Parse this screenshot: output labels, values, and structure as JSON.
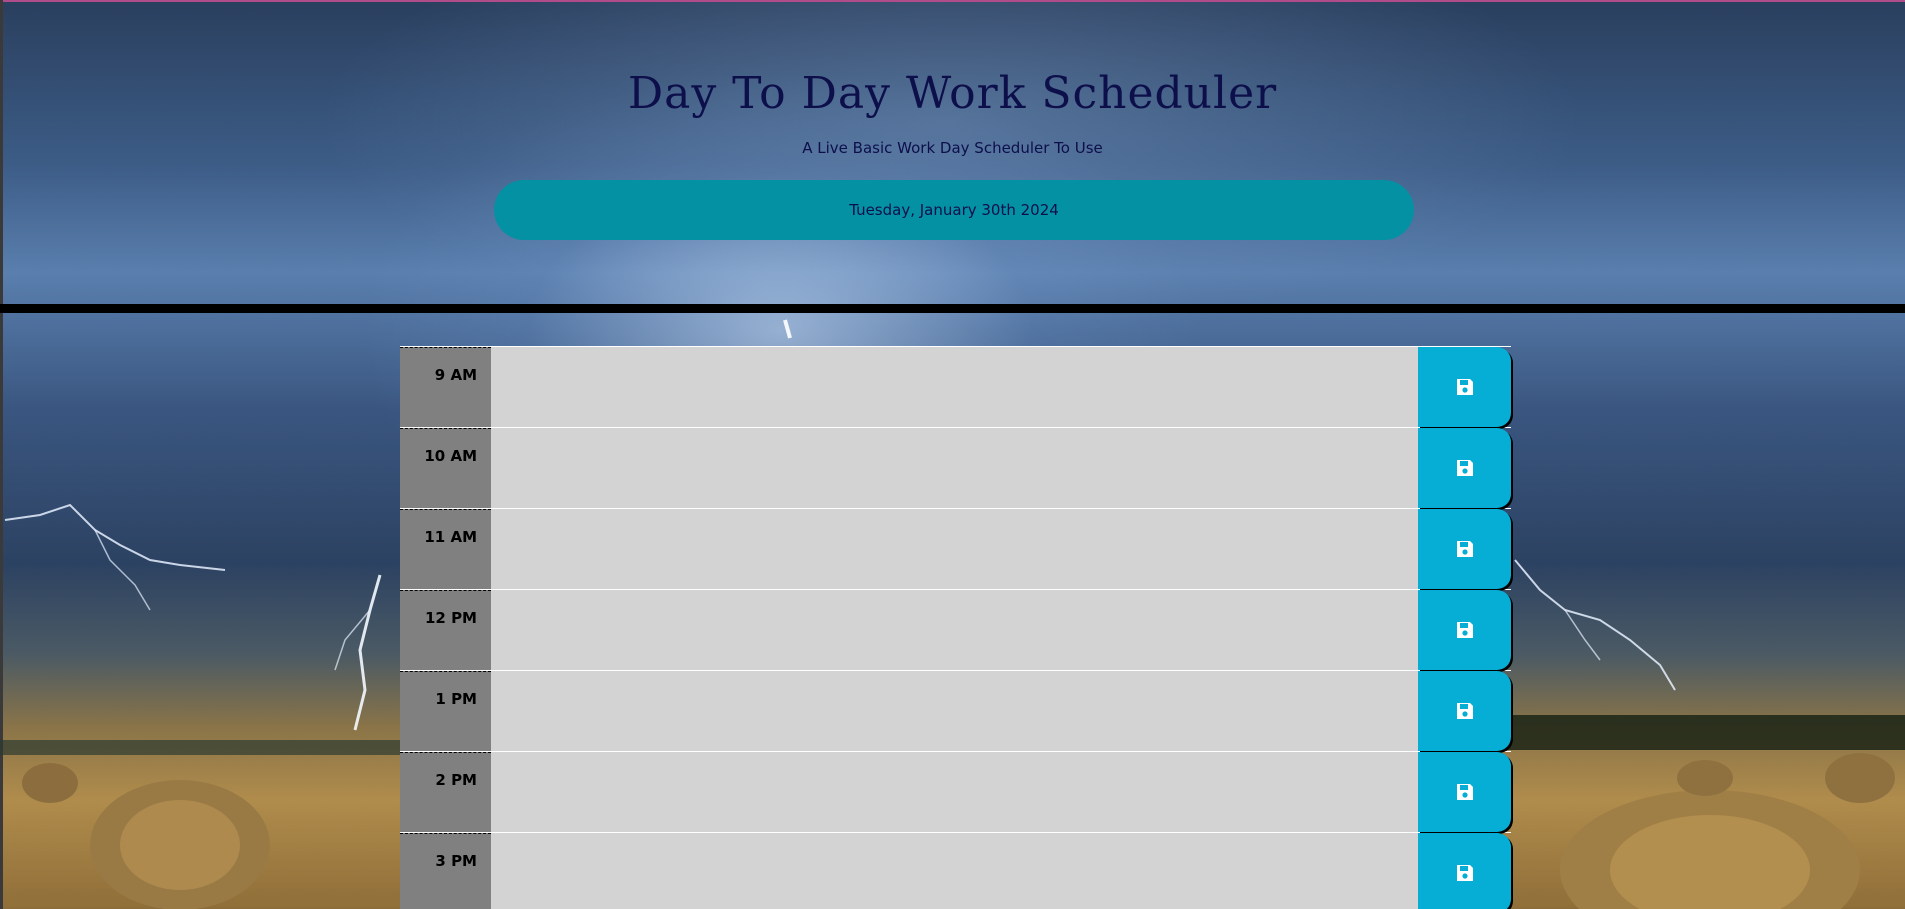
{
  "header": {
    "title": "Day To Day Work Scheduler",
    "subtitle": "A Live Basic Work Day Scheduler To Use",
    "current_date": "Tuesday, January 30th 2024"
  },
  "time_blocks": [
    {
      "hour": "9 AM",
      "description": ""
    },
    {
      "hour": "10 AM",
      "description": ""
    },
    {
      "hour": "11 AM",
      "description": ""
    },
    {
      "hour": "12 PM",
      "description": ""
    },
    {
      "hour": "1 PM",
      "description": ""
    },
    {
      "hour": "2 PM",
      "description": ""
    },
    {
      "hour": "3 PM",
      "description": ""
    }
  ],
  "icons": {
    "save": "floppy-disk-icon"
  },
  "colors": {
    "title": "#0d0f4a",
    "current_day_bg": "#0591a4",
    "save_button": "#06aed5",
    "hour_bg": "#808080",
    "row_bg": "#d3d3d3"
  }
}
